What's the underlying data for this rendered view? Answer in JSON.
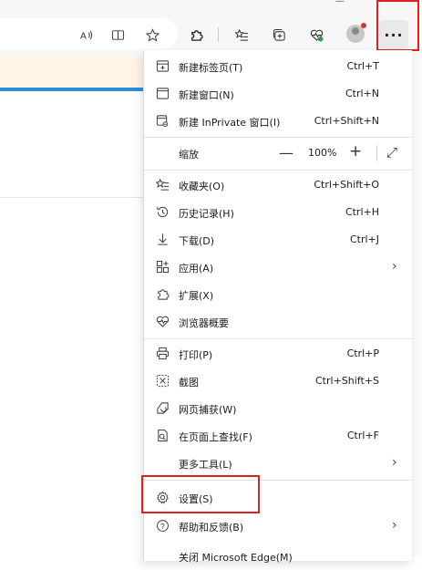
{
  "toolbar": {
    "read_aloud_icon": "read-aloud-icon",
    "split_screen_icon": "split-screen-icon",
    "favorite_star_icon": "star-icon",
    "extensions_icon": "puzzle-icon",
    "favorites_icon": "favorites-list-icon",
    "collections_icon": "collections-icon",
    "health_icon": "heart-pulse-icon",
    "profile_icon": "avatar-icon",
    "more_label": "···"
  },
  "menu": {
    "new_tab": {
      "label": "新建标签页(T)",
      "shortcut": "Ctrl+T"
    },
    "new_window": {
      "label": "新建窗口(N)",
      "shortcut": "Ctrl+N"
    },
    "new_inprivate": {
      "label": "新建 InPrivate 窗口(I)",
      "shortcut": "Ctrl+Shift+N"
    },
    "zoom": {
      "label": "缩放",
      "minus": "—",
      "level": "100%",
      "plus": "+",
      "fullscreen": "⤢"
    },
    "favorites": {
      "label": "收藏夹(O)",
      "shortcut": "Ctrl+Shift+O"
    },
    "history": {
      "label": "历史记录(H)",
      "shortcut": "Ctrl+H"
    },
    "downloads": {
      "label": "下载(D)",
      "shortcut": "Ctrl+J"
    },
    "apps": {
      "label": "应用(A)",
      "arrow": "›"
    },
    "extensions": {
      "label": "扩展(X)"
    },
    "browser_essentials": {
      "label": "浏览器概要"
    },
    "print": {
      "label": "打印(P)",
      "shortcut": "Ctrl+P"
    },
    "screenshot": {
      "label": "截图",
      "shortcut": "Ctrl+Shift+S"
    },
    "web_capture": {
      "label": "网页捕获(W)"
    },
    "find_on_page": {
      "label": "在页面上查找(F)",
      "shortcut": "Ctrl+F"
    },
    "more_tools": {
      "label": "更多工具(L)",
      "arrow": "›"
    },
    "settings": {
      "label": "设置(S)"
    },
    "help": {
      "label": "帮助和反馈(B)",
      "arrow": "›"
    },
    "close": {
      "label": "关闭 Microsoft Edge(M)"
    }
  },
  "colors": {
    "highlight": "#e02020",
    "accent": "#2b8fd6"
  }
}
